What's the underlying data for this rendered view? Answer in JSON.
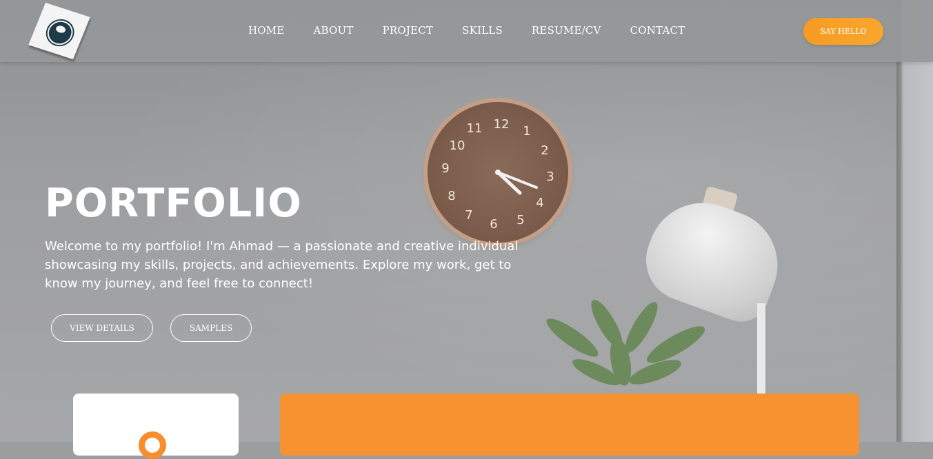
{
  "nav": {
    "logo_name": "logo-icon",
    "links": [
      "HOME",
      "ABOUT",
      "PROJECT",
      "SKILLS",
      "RESUME/CV",
      "CONTACT"
    ],
    "cta": "SAY HELLO"
  },
  "hero": {
    "title": "PORTFOLIO",
    "text": "Welcome to my portfolio! I'm Ahmad — a passionate and creative individual showcasing my skills, projects, and achievements. Explore my work, get to know my journey, and feel free to connect!",
    "buttons": {
      "details": "VIEW DETAILS",
      "samples": "SAMPLES"
    }
  },
  "colors": {
    "accent": "#f79230",
    "navbar": "#969799",
    "text": "#ffffff"
  }
}
